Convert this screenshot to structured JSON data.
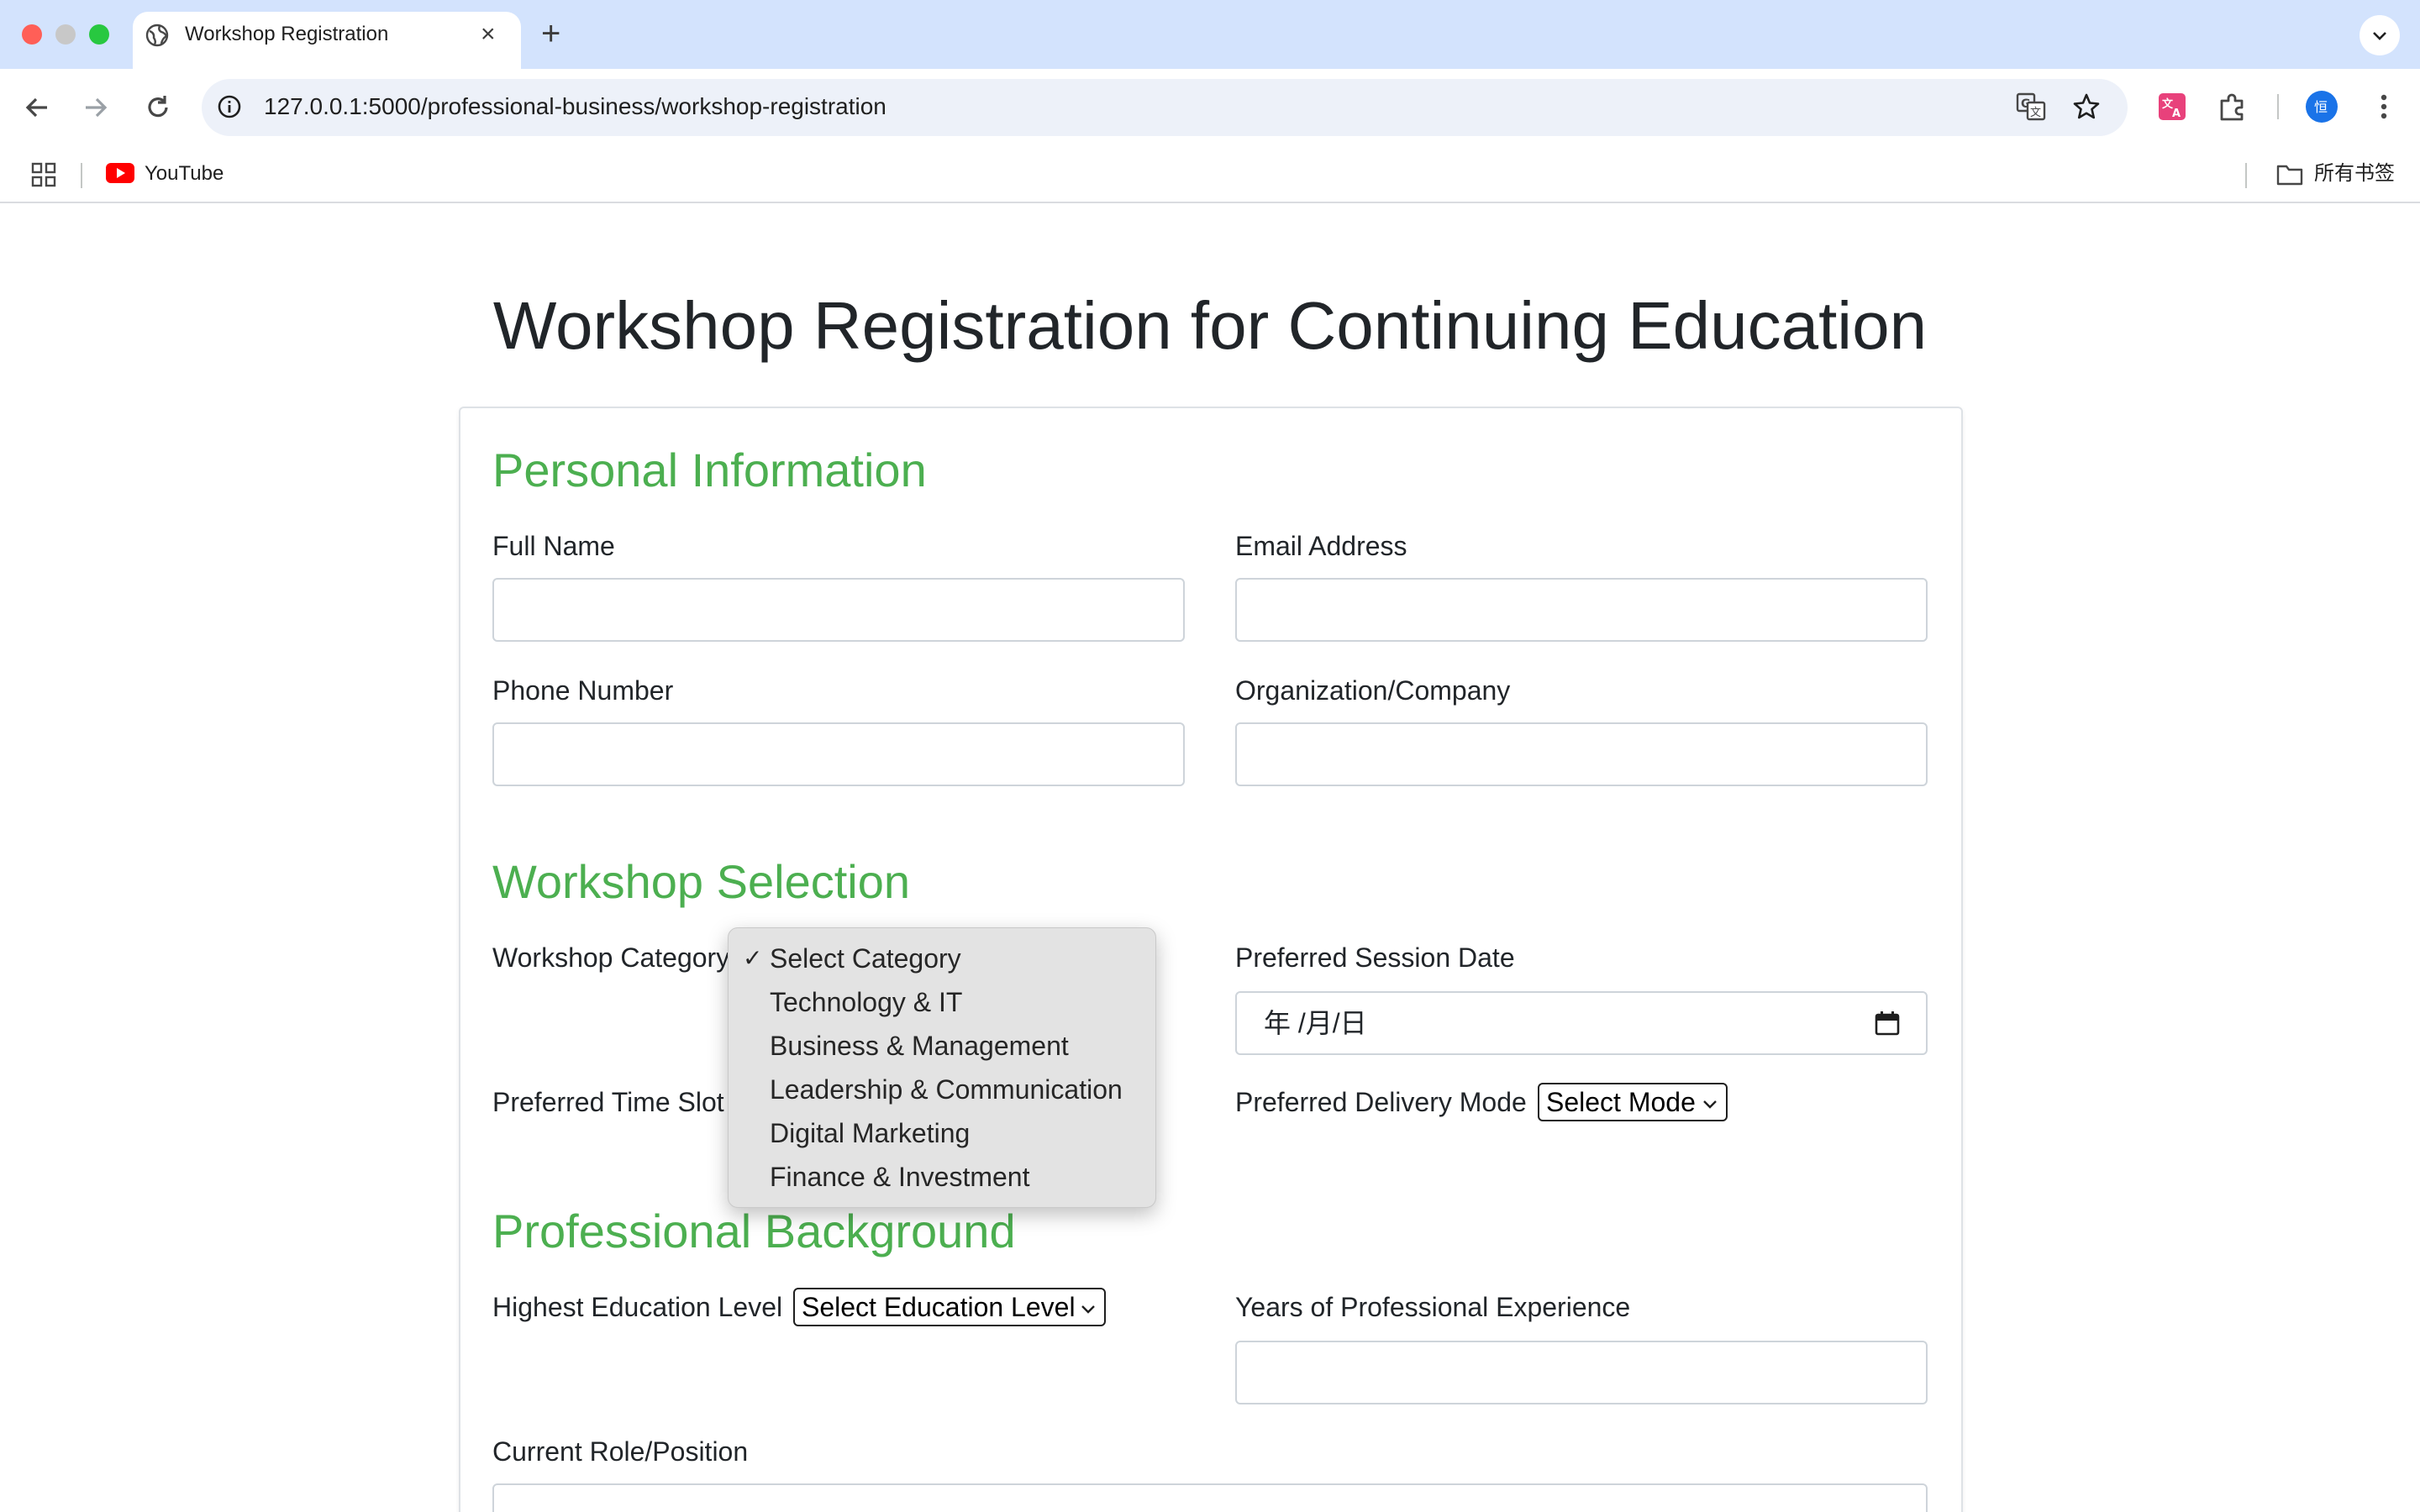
{
  "browser": {
    "tab_title": "Workshop Registration",
    "tab_close": "×",
    "new_tab": "+",
    "url": "127.0.0.1:5000/professional-business/workshop-registration",
    "bookmarks": [
      {
        "label": "YouTube",
        "icon": "youtube-icon"
      },
      {
        "label": "所有书签",
        "icon": "folder-icon"
      }
    ],
    "profile_initial": "恒"
  },
  "page": {
    "title": "Workshop Registration for Continuing Education"
  },
  "personal": {
    "heading": "Personal Information",
    "full_name_label": "Full Name",
    "email_label": "Email Address",
    "phone_label": "Phone Number",
    "org_label": "Organization/Company"
  },
  "workshop": {
    "heading": "Workshop Selection",
    "category_label": "Workshop Category",
    "category_options": [
      "Select Category",
      "Technology & IT",
      "Business & Management",
      "Leadership & Communication",
      "Digital Marketing",
      "Finance & Investment"
    ],
    "selected_check": "✓",
    "session_date_label": "Preferred Session Date",
    "date_placeholder": "年 /月/日",
    "time_slot_label": "Preferred Time Slot",
    "delivery_label": "Preferred Delivery Mode",
    "delivery_value": "Select Mode"
  },
  "background": {
    "heading": "Professional Background",
    "education_label": "Highest Education Level",
    "education_value": "Select Education Level",
    "experience_label": "Years of Professional Experience",
    "role_label": "Current Role/Position"
  },
  "colors": {
    "section_heading": "#4caf50",
    "tabstrip": "#d3e3fd"
  }
}
